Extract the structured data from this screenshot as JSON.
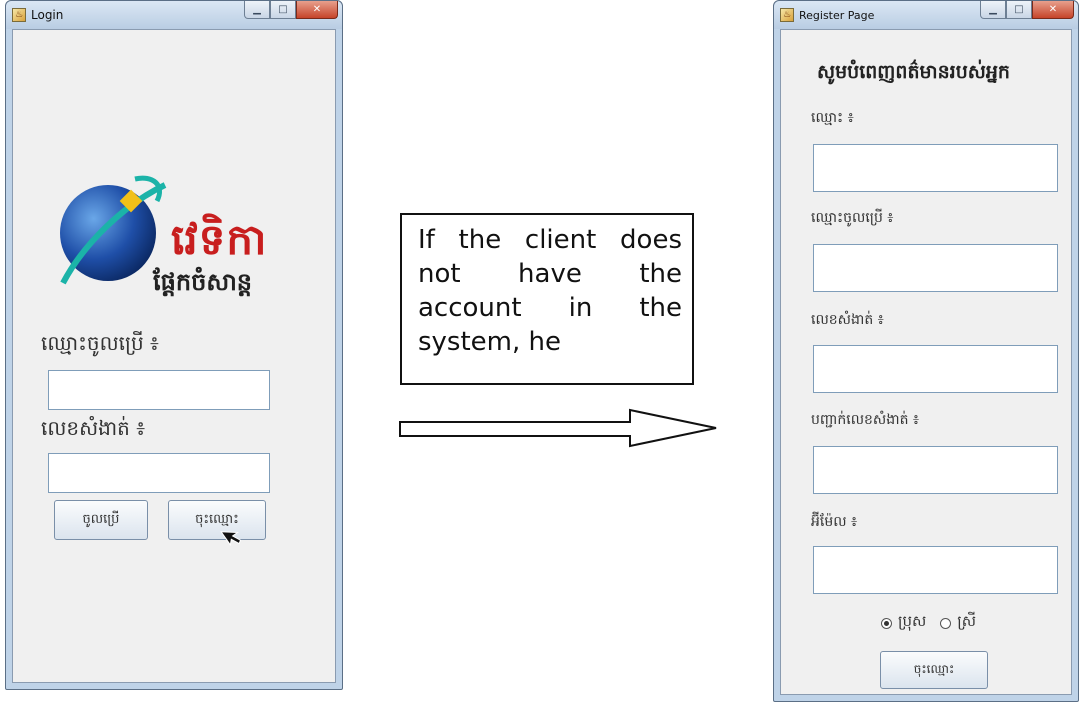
{
  "login_window": {
    "title": "Login",
    "logo": {
      "brand": "វេទិកា",
      "tagline": "ផ្ដែកចំសាន្ត"
    },
    "username_label": "ឈ្មោះចូលប្រើ ៖",
    "username_value": "",
    "password_label": "លេខសំងាត់ ៖",
    "password_value": "",
    "login_button": "ចូលប្រើ",
    "register_button": "ចុះឈ្មោះ"
  },
  "description": "If the client does not have the account in the system, he",
  "register_window": {
    "title": "Register Page",
    "heading": "សូមបំពេញពត៌មានរបស់អ្នក",
    "name_label": "ឈ្មោះ ៖",
    "name_value": "",
    "username_label": "ឈ្មោះចូលប្រើ ៖",
    "username_value": "",
    "password_label": "លេខសំងាត់ ៖",
    "password_value": "",
    "confirm_label": "បញ្ជាក់លេខសំងាត់ ៖",
    "confirm_value": "",
    "email_label": "អ៊ីម៉ែល ៖",
    "email_value": "",
    "gender_male": "ប្រុស",
    "gender_female": "ស្រី",
    "gender_selected": "male",
    "register_button": "ចុះឈ្មោះ"
  },
  "colors": {
    "window_frame": "#bfd3e8",
    "client_bg": "#f0f0f0",
    "close_red": "#c6442a",
    "logo_red": "#c81e1e"
  },
  "icons": [
    "app-icon",
    "minimize-icon",
    "maximize-icon",
    "close-icon",
    "mouse-pointer-icon",
    "arrow-icon",
    "globe-icon"
  ]
}
